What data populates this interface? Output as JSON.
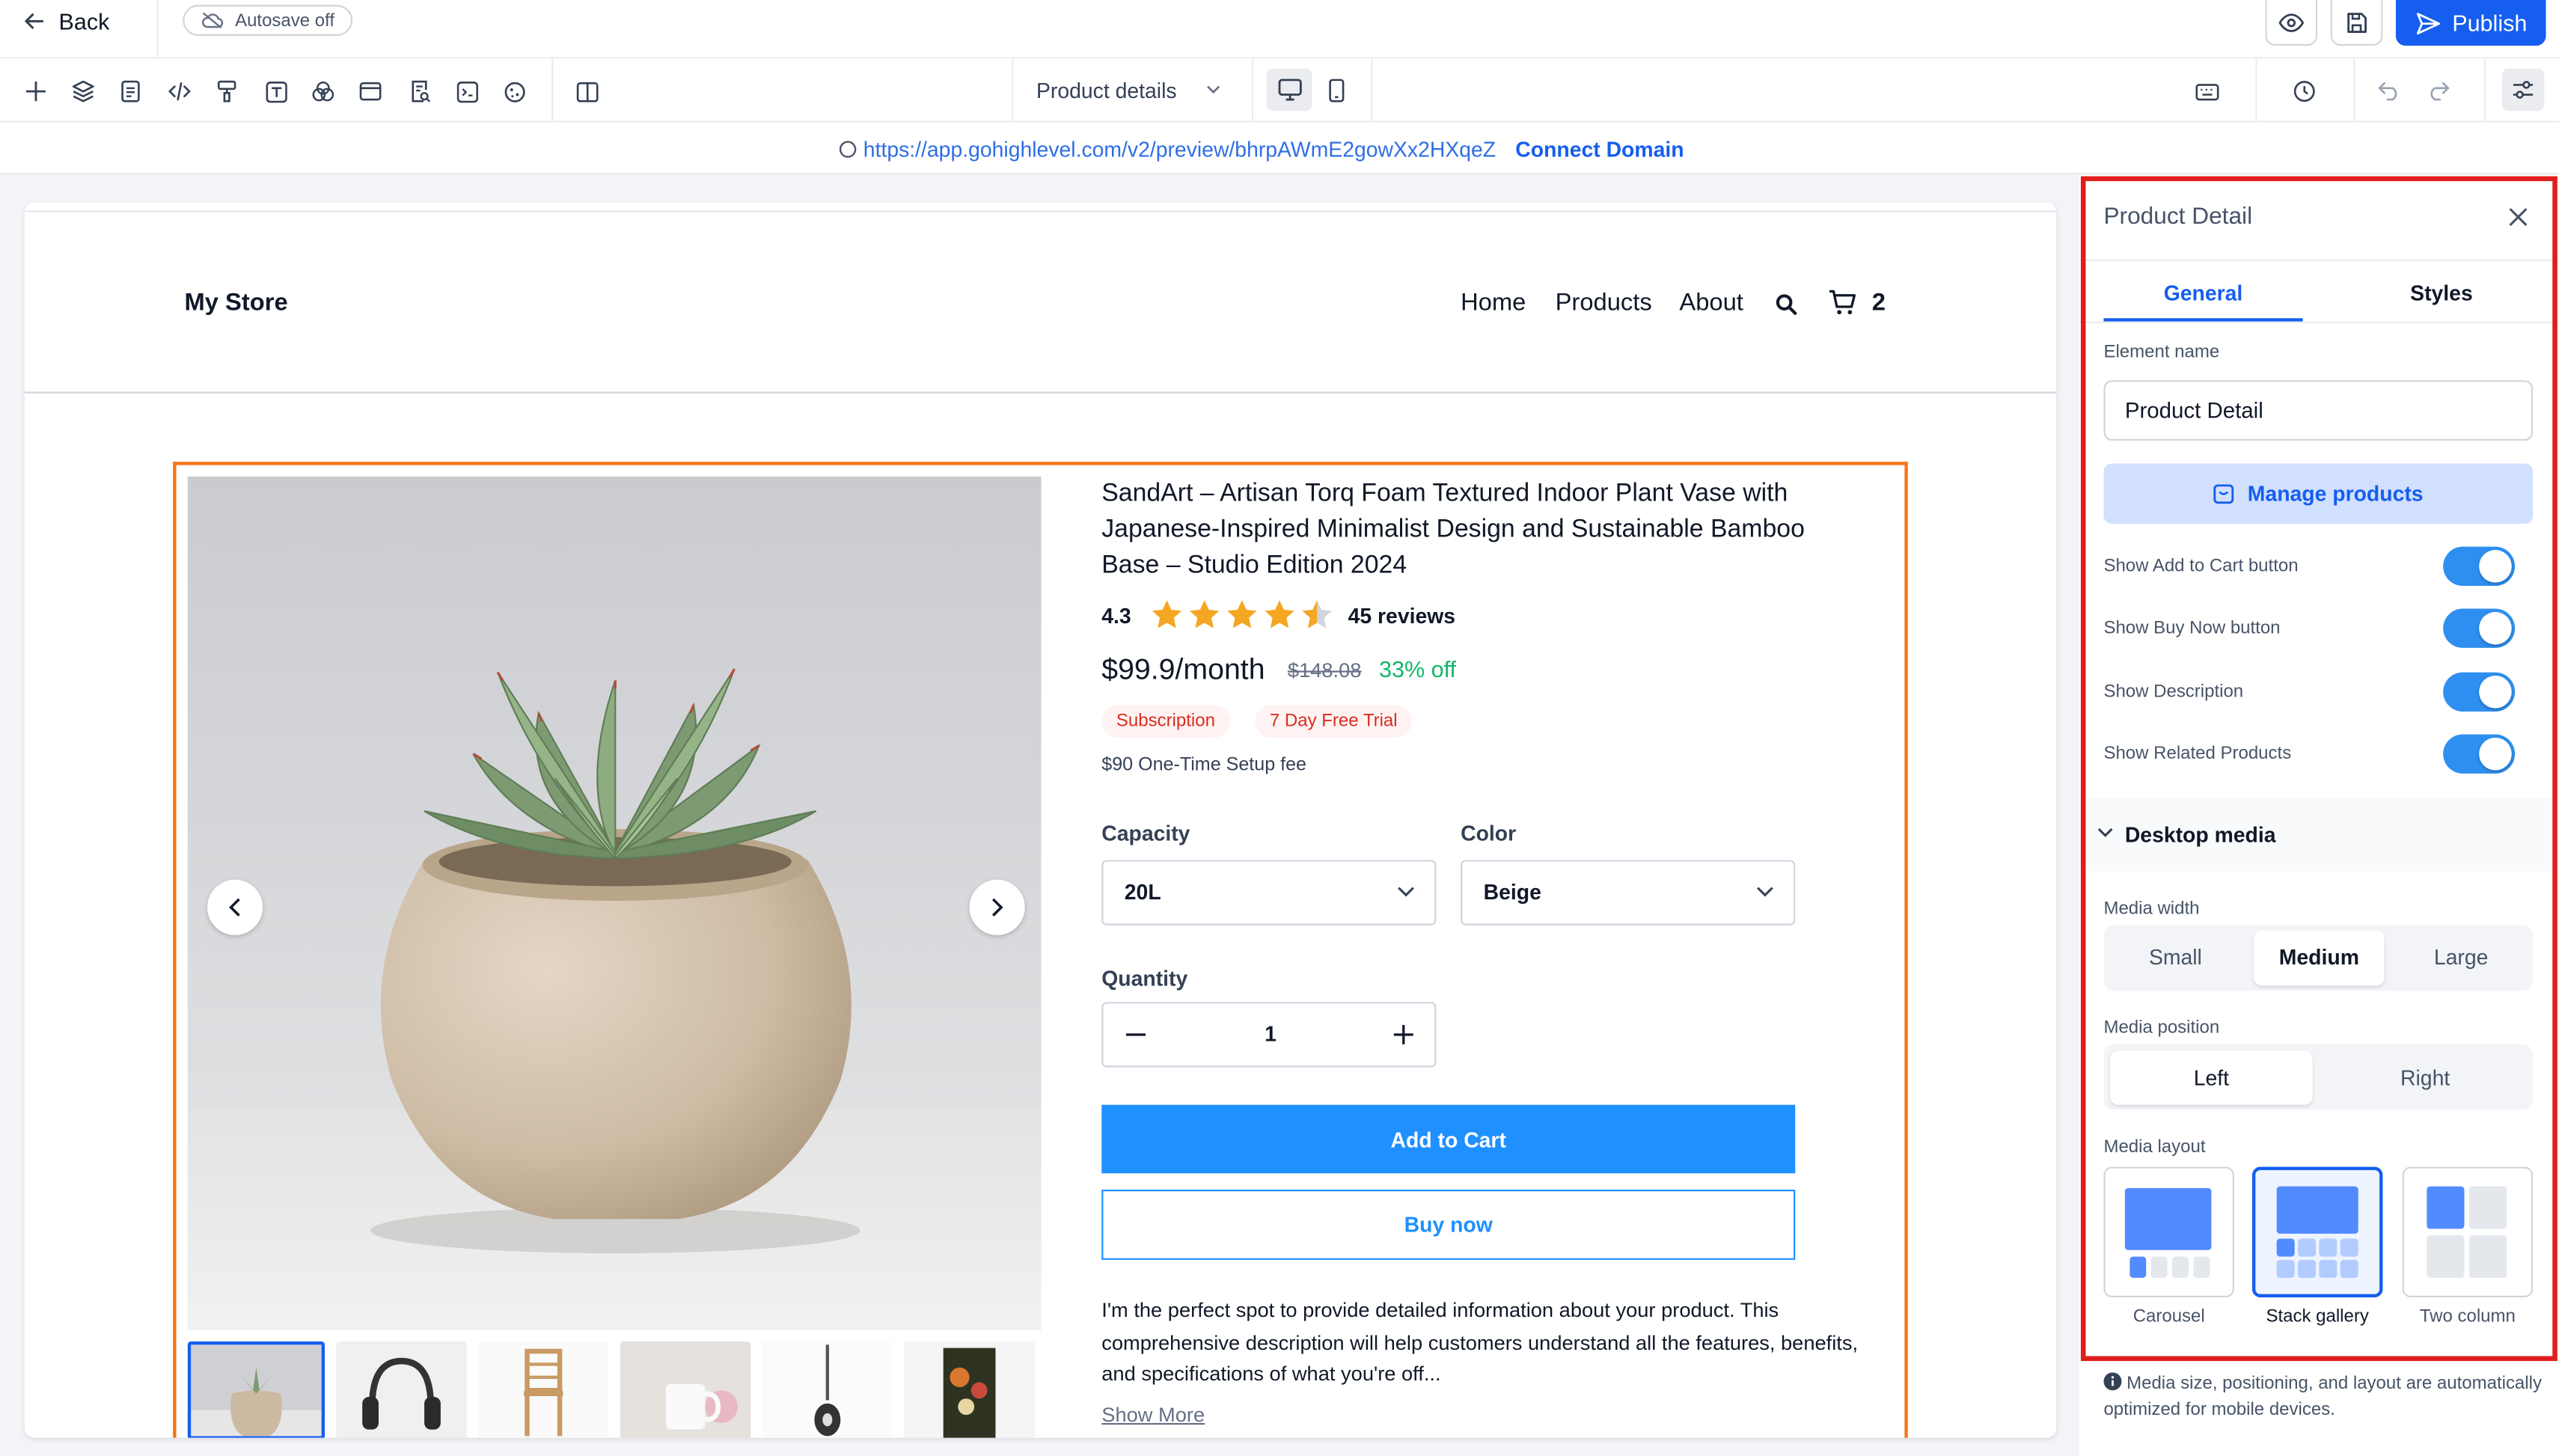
{
  "topbar": {
    "back_label": "Back",
    "autosave_label": "Autosave off",
    "publish_label": "Publish"
  },
  "toolbar": {
    "page_selector": "Product details"
  },
  "urlbar": {
    "url": "https://app.gohighlevel.com/v2/preview/bhrpAWmE2gowXx2HXqeZ",
    "connect_label": "Connect Domain"
  },
  "store": {
    "brand": "My Store",
    "nav": [
      "Home",
      "Products",
      "About"
    ],
    "cart_count": "2"
  },
  "product": {
    "title": "SandArt – Artisan Torq Foam Textured Indoor Plant Vase with Japanese-Inspired Minimalist Design and Sustainable Bamboo Base – Studio Edition 2024",
    "rating": "4.3",
    "rating_value": 4.3,
    "reviews": "45 reviews",
    "price": "$99.9/month",
    "old_price": "$148.08",
    "discount": "33% off",
    "tags": [
      "Subscription",
      "7 Day Free Trial"
    ],
    "setup_fee": "$90 One-Time Setup fee",
    "capacity_label": "Capacity",
    "capacity_value": "20L",
    "color_label": "Color",
    "color_value": "Beige",
    "quantity_label": "Quantity",
    "quantity_value": "1",
    "add_to_cart": "Add to Cart",
    "buy_now": "Buy now",
    "description": "I'm the perfect spot to provide detailed information about your product. This comprehensive description will help customers understand all the features, benefits, and specifications of what you're off...",
    "show_more": "Show More"
  },
  "panel": {
    "title": "Product Detail",
    "tabs": [
      "General",
      "Styles"
    ],
    "element_name_label": "Element name",
    "element_name_value": "Product Detail",
    "manage_products": "Manage products",
    "toggles": [
      "Show Add to Cart button",
      "Show Buy Now button",
      "Show Description",
      "Show Related Products"
    ],
    "desktop_media": "Desktop media",
    "media_width_label": "Media width",
    "media_width_options": [
      "Small",
      "Medium",
      "Large"
    ],
    "media_position_label": "Media position",
    "media_position_options": [
      "Left",
      "Right"
    ],
    "media_layout_label": "Media layout",
    "media_layout_options": [
      "Carousel",
      "Stack gallery",
      "Two column"
    ],
    "note": "Media size, positioning, and layout are automatically optimized for mobile devices."
  },
  "colors": {
    "accent": "#155eef",
    "publish": "#155eef",
    "selection_orange": "#f97316",
    "panel_highlight": "#e11d1d",
    "cart_button": "#1e90ff",
    "toggle": "#2e8ff0",
    "discount": "#12b76a",
    "star": "#f5a623"
  }
}
